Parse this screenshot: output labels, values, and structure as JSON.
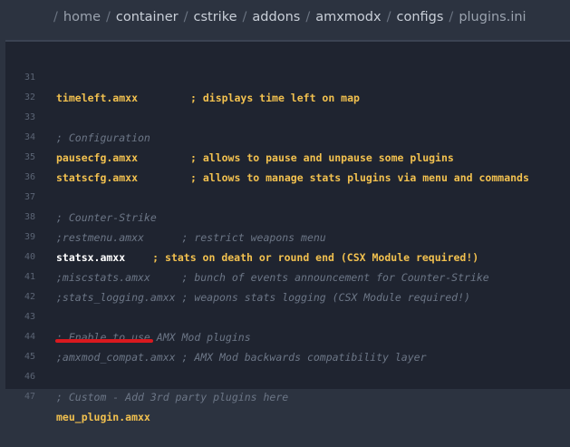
{
  "breadcrumb": {
    "items": [
      "home",
      "container",
      "cstrike",
      "addons",
      "amxmodx",
      "configs",
      "plugins.ini"
    ],
    "separator": "/"
  },
  "editor": {
    "lines": [
      {
        "num": "31",
        "code": "timeleft.amxx",
        "comment": "; displays time left on map"
      },
      {
        "num": "32",
        "code": "",
        "comment": ""
      },
      {
        "num": "33",
        "code": "",
        "comment": "; Configuration"
      },
      {
        "num": "34",
        "code": "pausecfg.amxx",
        "comment": "; allows to pause and unpause some plugins"
      },
      {
        "num": "35",
        "code": "statscfg.amxx",
        "comment": "; allows to manage stats plugins via menu and commands"
      },
      {
        "num": "36",
        "code": "",
        "comment": ""
      },
      {
        "num": "37",
        "code": "",
        "comment": "; Counter-Strike"
      },
      {
        "num": "38",
        "code": "",
        "comment": ";restmenu.amxx      ; restrict weapons menu"
      },
      {
        "num": "39",
        "code": "statsx.amxx",
        "comment": "; stats on death or round end (CSX Module required!)"
      },
      {
        "num": "40",
        "code": "",
        "comment": ";miscstats.amxx     ; bunch of events announcement for Counter-Strike"
      },
      {
        "num": "41",
        "code": "",
        "comment": ";stats_logging.amxx ; weapons stats logging (CSX Module required!)"
      },
      {
        "num": "42",
        "code": "",
        "comment": ""
      },
      {
        "num": "43",
        "code": "",
        "comment": "; Enable to use AMX Mod plugins"
      },
      {
        "num": "44",
        "code": "",
        "comment": ";amxmod_compat.amxx ; AMX Mod backwards compatibility layer"
      },
      {
        "num": "45",
        "code": "",
        "comment": ""
      },
      {
        "num": "46",
        "code": "",
        "comment": "; Custom - Add 3rd party plugins here"
      },
      {
        "num": "47",
        "code": "meu_plugin.amxx",
        "comment": ""
      }
    ],
    "highlight_color": "#d9191f"
  }
}
